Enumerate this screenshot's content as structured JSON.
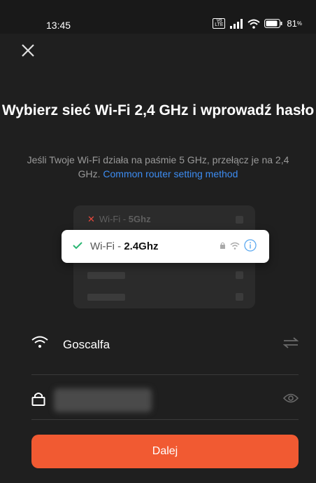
{
  "status_bar": {
    "time": "13:45",
    "network_badge": "LTE",
    "battery": "81",
    "battery_unit": "%"
  },
  "title": "Wybierz sieć Wi-Fi 2,4 GHz i wprowadź hasło",
  "subtitle": {
    "text": "Jeśli Twoje Wi-Fi działa na paśmie 5 GHz, przełącz je na 2,4 GHz.",
    "link": "Common router setting method"
  },
  "illustration": {
    "bad_prefix": "Wi-Fi - ",
    "bad_band": "5Ghz",
    "good_prefix": "Wi-Fi - ",
    "good_band": "2.4Ghz"
  },
  "wifi_field": {
    "value": "Goscalfa",
    "icon": "wifi-icon",
    "action_icon": "swap-icon"
  },
  "password_field": {
    "icon": "lock-icon",
    "action_icon": "eye-icon"
  },
  "next_button": "Dalej",
  "colors": {
    "accent": "#f15a32",
    "link": "#3d8df3",
    "ok": "#2bb673",
    "bad": "#e8473b"
  }
}
